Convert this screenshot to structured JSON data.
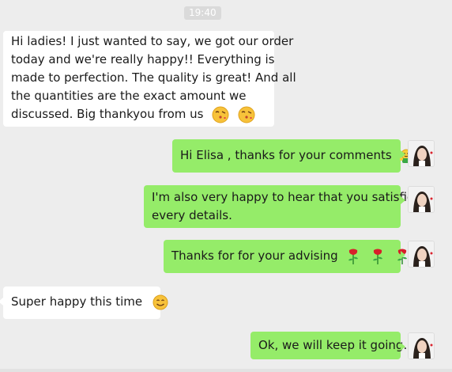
{
  "timestamp": "19:40",
  "messages": [
    {
      "side": "in",
      "lines": [
        "Hi ladies! I just wanted to say, we got our order",
        "today and we're really happy!! Everything is",
        "made to perfection. The quality is great! And all",
        "the quantities are the exact amount we",
        "discussed. Big thankyou from us"
      ],
      "emojis": [
        "kiss-face-emoji",
        "kiss-face-emoji"
      ]
    },
    {
      "side": "out",
      "text": "Hi Elisa , thanks for your comments",
      "emojis": [
        "hug-emoji"
      ]
    },
    {
      "side": "out",
      "lines": [
        "I'm also very happy to hear that you satisfied",
        "every details."
      ]
    },
    {
      "side": "out",
      "text": "Thanks for for your advising",
      "emojis": [
        "rose-emoji",
        "rose-emoji",
        "rose-emoji"
      ]
    },
    {
      "side": "in",
      "text": "Super happy this time",
      "emojis": [
        "smile-emoji"
      ]
    },
    {
      "side": "out",
      "text": "Ok, we will keep it going."
    }
  ],
  "colors": {
    "background": "#ededed",
    "outgoing_bubble": "#95ec69",
    "incoming_bubble": "#ffffff",
    "timestamp_bg": "#dadada"
  }
}
